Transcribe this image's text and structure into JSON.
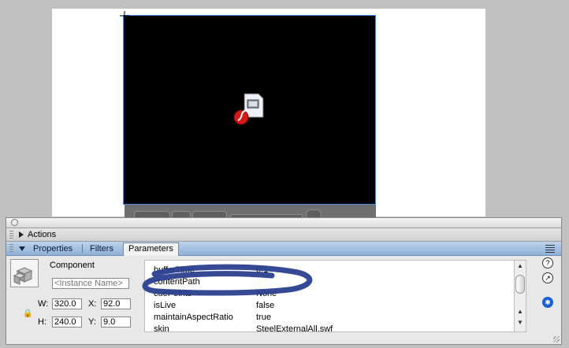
{
  "panel": {
    "actions_label": "Actions",
    "tabs": [
      {
        "label": "Properties",
        "active": false
      },
      {
        "label": "Filters",
        "active": false
      },
      {
        "label": "Parameters",
        "active": true
      }
    ]
  },
  "inspector": {
    "component_label": "Component",
    "instance_placeholder": "<Instance Name>",
    "w_label": "W:",
    "w_value": "320.0",
    "x_label": "X:",
    "x_value": "92.0",
    "h_label": "H:",
    "h_value": "240.0",
    "y_label": "Y:",
    "y_value": "9.0"
  },
  "parameters": [
    {
      "name": "bufferTime",
      "value": "0.1"
    },
    {
      "name": "contentPath",
      "value": ""
    },
    {
      "name": "cuePoints",
      "value": "None"
    },
    {
      "name": "isLive",
      "value": "false"
    },
    {
      "name": "maintainAspectRatio",
      "value": "true"
    },
    {
      "name": "skin",
      "value": "SteelExternalAll.swf"
    }
  ],
  "side_icons": [
    "help-icon",
    "external-link-icon",
    "accessibility-icon"
  ],
  "colors": {
    "tab_bar": "#9fbfe2",
    "scribble": "#2a3f8f",
    "stage_bg": "#000000"
  }
}
